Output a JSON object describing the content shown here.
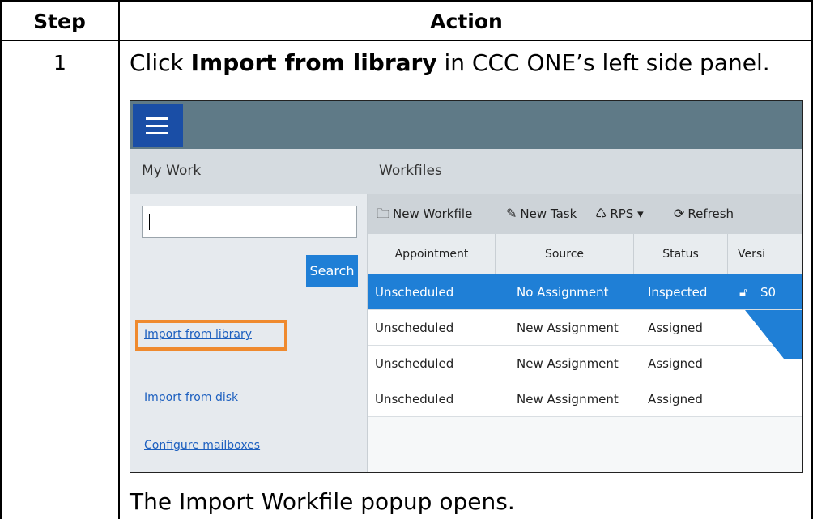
{
  "table": {
    "headers": {
      "step": "Step",
      "action": "Action"
    },
    "row": {
      "step_number": "1",
      "instruction_pre": "Click ",
      "instruction_bold": "Import from library",
      "instruction_post": " in CCC ONE’s left side panel.",
      "result": "The Import Workfile popup opens."
    }
  },
  "screenshot": {
    "left_panel": {
      "title": "My Work",
      "search_value": "",
      "search_button": "Search",
      "links": [
        "Import from library",
        "Import from disk",
        "Configure mailboxes"
      ]
    },
    "right_panel": {
      "title": "Workfiles",
      "toolbar": [
        {
          "icon": "folder-icon",
          "label": "New Workfile"
        },
        {
          "icon": "new-task-icon",
          "label": "New Task"
        },
        {
          "icon": "recycle-icon",
          "label": "RPS ▾"
        },
        {
          "icon": "refresh-icon",
          "label": "Refresh"
        }
      ],
      "columns": [
        "Appointment",
        "Source",
        "Status",
        "Versi"
      ],
      "rows": [
        {
          "appointment": "Unscheduled",
          "source": "No Assignment",
          "status": "Inspected",
          "version": "S0",
          "selected": true
        },
        {
          "appointment": "Unscheduled",
          "source": "New Assignment",
          "status": "Assigned",
          "version": "",
          "selected": false
        },
        {
          "appointment": "Unscheduled",
          "source": "New Assignment",
          "status": "Assigned",
          "version": "",
          "selected": false
        },
        {
          "appointment": "Unscheduled",
          "source": "New Assignment",
          "status": "Assigned",
          "version": "",
          "selected": false
        }
      ]
    },
    "colors": {
      "accent": "#1f7fd6",
      "highlight": "#ef8a2e",
      "topbar": "#5f7a87"
    }
  }
}
